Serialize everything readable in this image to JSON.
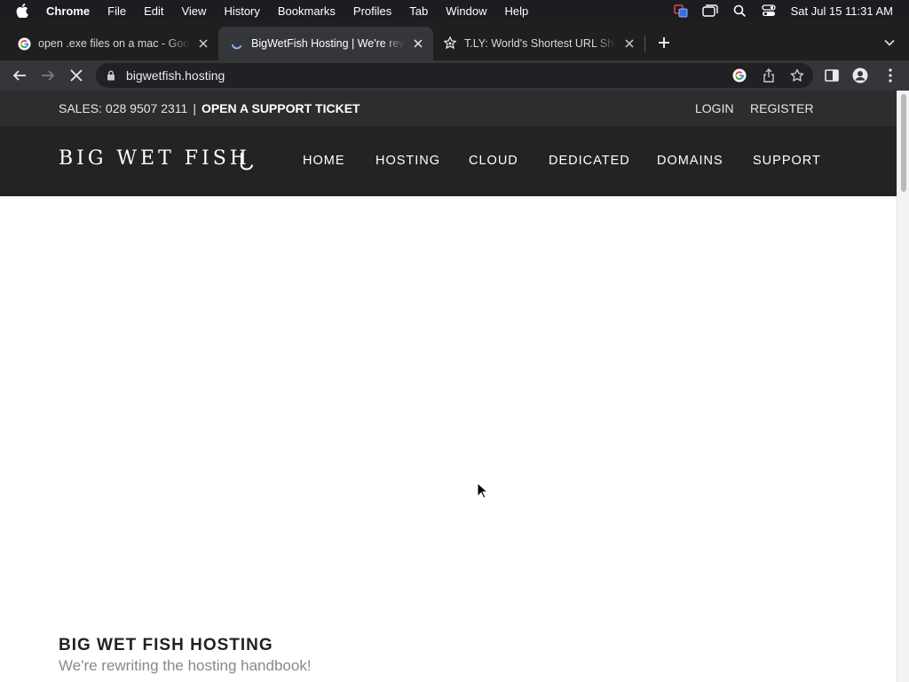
{
  "menubar": {
    "app_name": "Chrome",
    "items": [
      "File",
      "Edit",
      "View",
      "History",
      "Bookmarks",
      "Profiles",
      "Tab",
      "Window",
      "Help"
    ],
    "clock": "Sat Jul 15  11:31 AM",
    "tray_icons": [
      "screen-share-icon",
      "window-icon",
      "spotlight-search-icon",
      "control-center-icon"
    ]
  },
  "tabs": [
    {
      "title": "open .exe files on a mac - Google",
      "favicon": "google-icon",
      "active": false
    },
    {
      "title": "BigWetFish Hosting | We're rewriting",
      "favicon": "loading-spinner-icon",
      "active": true
    },
    {
      "title": "T.LY: World's Shortest URL Shortener",
      "favicon": "tly-icon",
      "active": false
    }
  ],
  "toolbar": {
    "url": "bigwetfish.hosting",
    "icons": [
      "back-icon",
      "forward-icon",
      "stop-loading-icon",
      "lock-icon",
      "google-lens-icon",
      "share-icon",
      "bookmark-star-icon",
      "side-panel-icon",
      "profile-icon",
      "menu-kebab-icon"
    ]
  },
  "site": {
    "sales": "SALES: 028 9507 2311",
    "separator": "|",
    "ticket": "OPEN A SUPPORT TICKET",
    "login": "LOGIN",
    "register": "REGISTER",
    "logo": "BIG WET FISH",
    "nav": [
      "HOME",
      "HOSTING",
      "CLOUD",
      "DEDICATED",
      "DOMAINS",
      "SUPPORT"
    ],
    "headline": "BIG WET FISH HOSTING",
    "tagline": "We're rewriting the hosting handbook!"
  },
  "colors": {
    "menubar_bg": "#1d1c21",
    "tabstrip_bg": "#1f1f20",
    "toolbar_bg": "#35363a",
    "omnibox_bg": "#202124",
    "site_topbar_bg": "#2d2d2d",
    "site_nav_bg": "#232323"
  }
}
